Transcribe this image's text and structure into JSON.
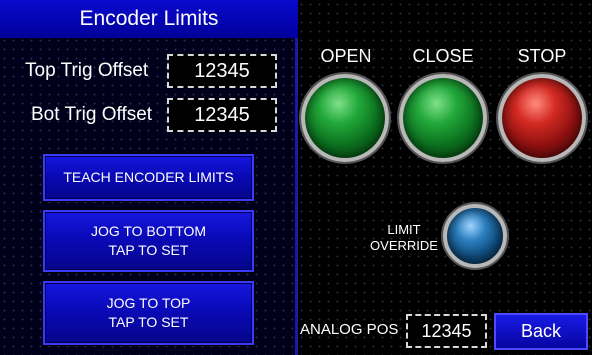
{
  "title": "Encoder Limits",
  "fields": {
    "top_trig_offset": {
      "label": "Top Trig Offset",
      "value": "12345"
    },
    "bot_trig_offset": {
      "label": "Bot Trig Offset",
      "value": "12345"
    }
  },
  "buttons": {
    "teach_encoder_limits": "TEACH ENCODER LIMITS",
    "jog_bottom_line1": "JOG TO BOTTOM",
    "jog_bottom_line2": "TAP TO SET",
    "jog_top_line1": "JOG TO TOP",
    "jog_top_line2": "TAP TO SET",
    "back": "Back"
  },
  "lamps": {
    "open": {
      "label": "OPEN",
      "color": "#1f9a35"
    },
    "close": {
      "label": "CLOSE",
      "color": "#1f9a35"
    },
    "stop": {
      "label": "STOP",
      "color": "#c02020"
    },
    "limit_override": {
      "label_line1": "LIMIT",
      "label_line2": "OVERRIDE",
      "color": "#2b7fbf"
    }
  },
  "analog_pos": {
    "label": "ANALOG POS",
    "value": "12345"
  },
  "colors": {
    "title_bar": "#0a0ad0",
    "button_blue": "#0a0ab8",
    "divider": "#1a1aa8"
  }
}
